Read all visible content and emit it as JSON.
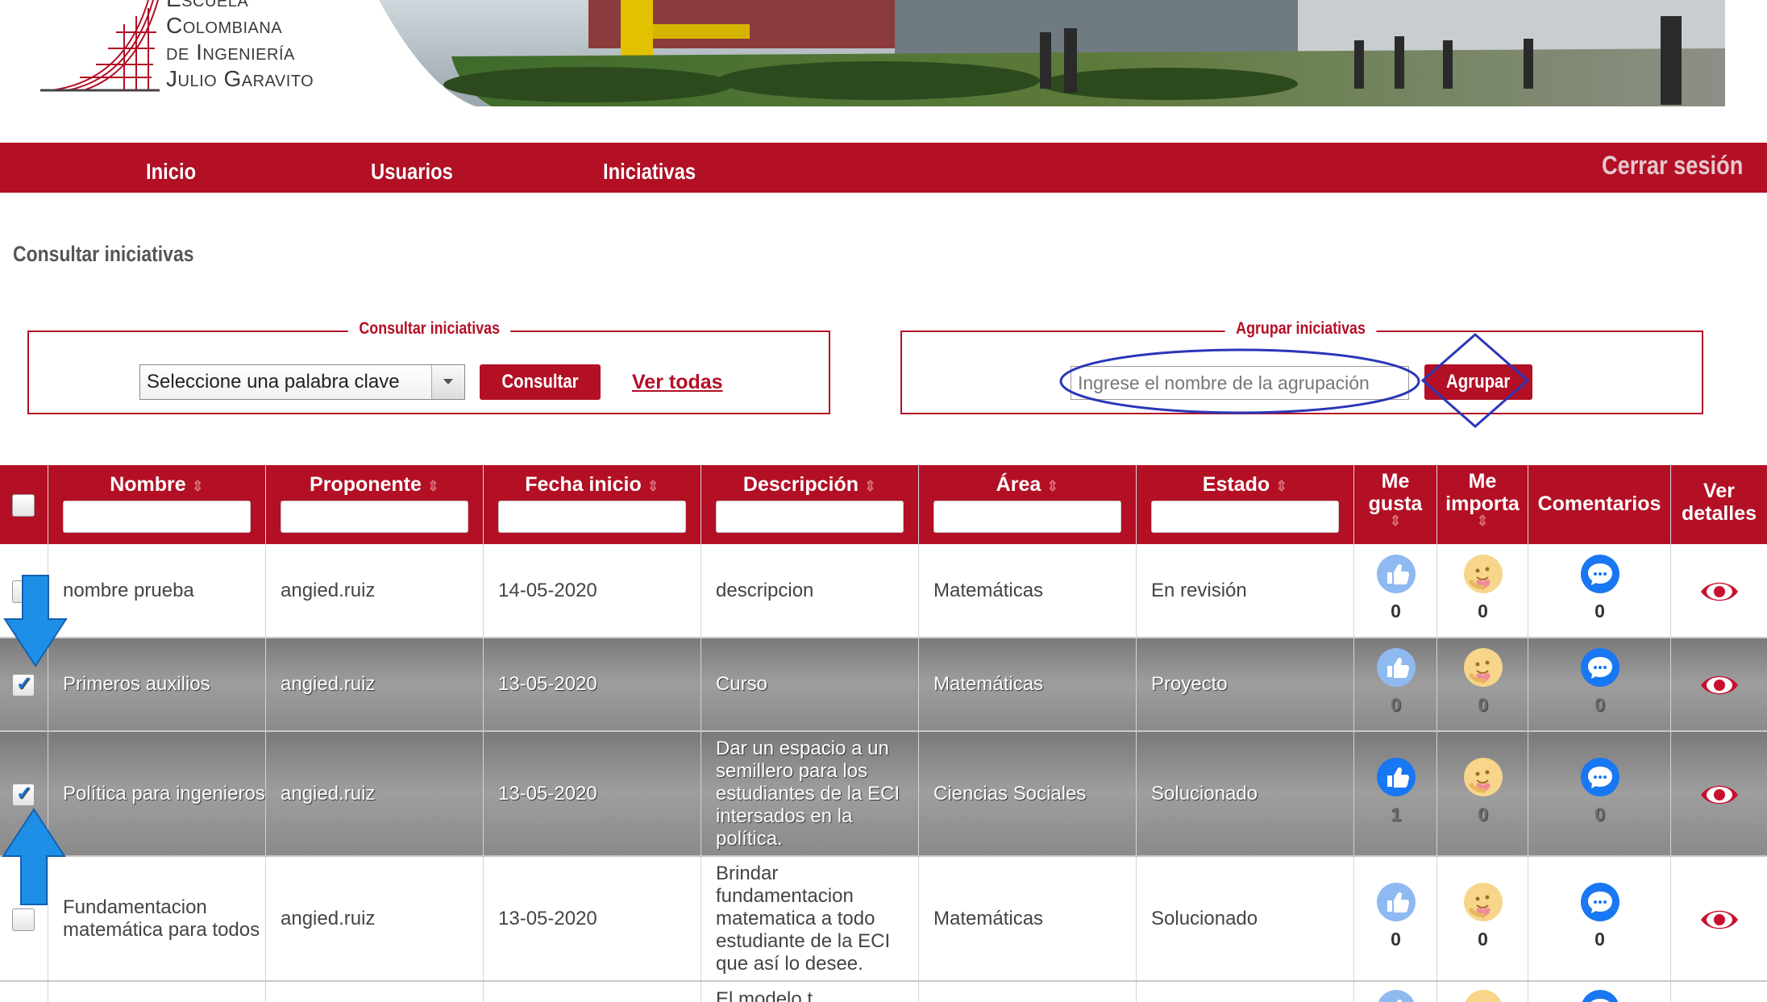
{
  "logo": {
    "lines": [
      "Escuela",
      "Colombiana",
      "de Ingeniería",
      "Julio Garavito"
    ]
  },
  "nav": {
    "items": [
      "Inicio",
      "Usuarios",
      "Iniciativas"
    ],
    "logout": "Cerrar sesión"
  },
  "page_title": "Consultar iniciativas",
  "consultar_panel": {
    "legend": "Consultar iniciativas",
    "select_value": "Seleccione una palabra clave",
    "button": "Consultar",
    "link": "Ver todas"
  },
  "agrupar_panel": {
    "legend": "Agrupar iniciativas",
    "input_placeholder": "Ingrese el nombre de la agrupación",
    "button": "Agrupar"
  },
  "table": {
    "headers": {
      "nombre": "Nombre",
      "proponente": "Proponente",
      "fecha": "Fecha inicio",
      "descripcion": "Descripción",
      "area": "Área",
      "estado": "Estado",
      "megusta": "Me gusta",
      "meimporta": "Me importa",
      "comentarios": "Comentarios",
      "detalles": "Ver detalles"
    },
    "sort_glyph": "⇕",
    "rows": [
      {
        "nombre": "nombre prueba",
        "proponente": "angied.ruiz",
        "fecha": "14-05-2020",
        "descripcion": "descripcion",
        "area": "Matemáticas",
        "estado": "En revisión",
        "megusta": "0",
        "meimporta": "0",
        "comentarios": "0",
        "checked": false,
        "liked": false
      },
      {
        "nombre": "Primeros auxilios",
        "proponente": "angied.ruiz",
        "fecha": "13-05-2020",
        "descripcion": "Curso",
        "area": "Matemáticas",
        "estado": "Proyecto",
        "megusta": "0",
        "meimporta": "0",
        "comentarios": "0",
        "checked": true,
        "liked": false
      },
      {
        "nombre": "Política para ingenieros",
        "proponente": "angied.ruiz",
        "fecha": "13-05-2020",
        "descripcion": "Dar un espacio a un semillero para los estudiantes de la ECI intersados en la política.",
        "area": "Ciencias Sociales",
        "estado": "Solucionado",
        "megusta": "1",
        "meimporta": "0",
        "comentarios": "0",
        "checked": true,
        "liked": true
      },
      {
        "nombre": "Fundamentacion matemática para todos",
        "proponente": "angied.ruiz",
        "fecha": "13-05-2020",
        "descripcion": "Brindar fundamentacion matematica a todo estudiante de la ECI que así lo desee.",
        "area": "Matemáticas",
        "estado": "Solucionado",
        "megusta": "0",
        "meimporta": "0",
        "comentarios": "0",
        "checked": false,
        "liked": false
      },
      {
        "nombre": "",
        "proponente": "",
        "fecha": "",
        "descripcion": "El modelo t",
        "area": "",
        "estado": "",
        "megusta": "",
        "meimporta": "",
        "comentarios": "",
        "checked": false,
        "liked": false
      }
    ]
  },
  "colors": {
    "brand_red": "#b30f25",
    "like_blue": "#1877f2",
    "annotation_blue": "#2a36b8",
    "arrow_blue": "#1e8fe6"
  },
  "icons": {
    "like": "thumbs-up-icon",
    "care": "care-emoji-icon",
    "comment": "chat-bubble-icon",
    "details": "eye-icon"
  }
}
